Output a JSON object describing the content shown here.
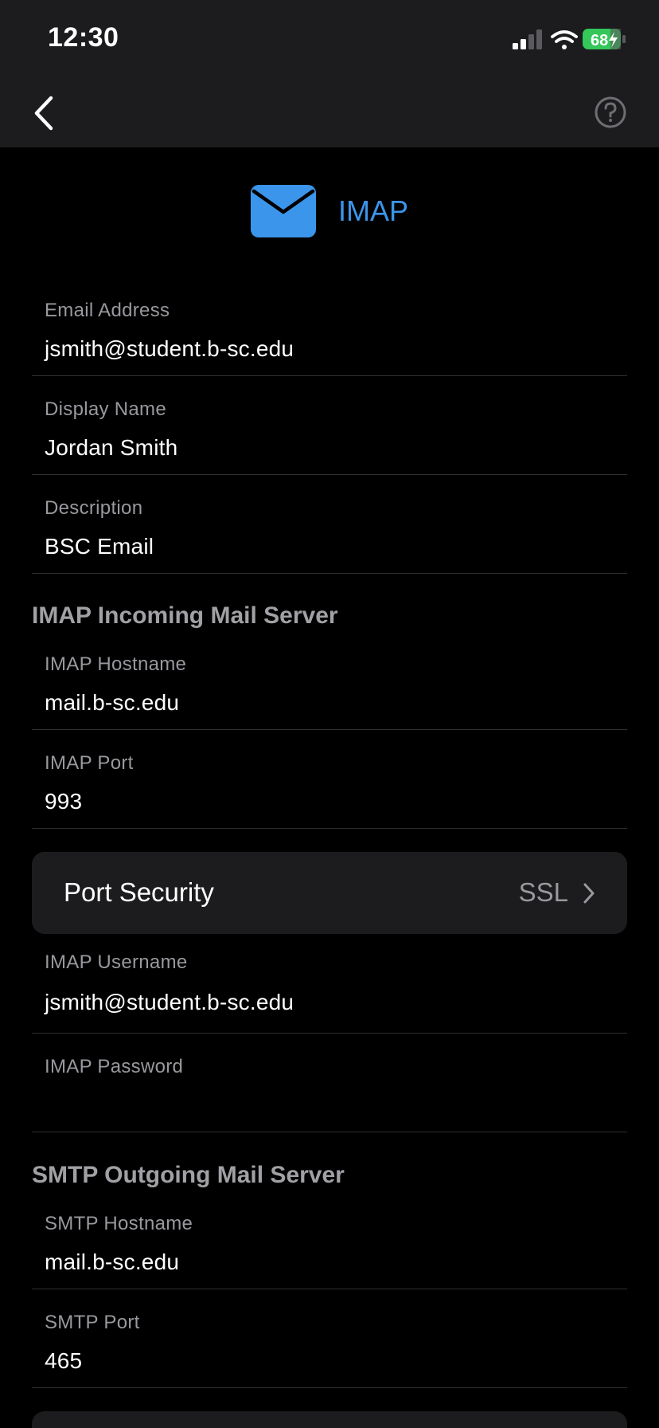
{
  "status_bar": {
    "time": "12:30",
    "battery": "68"
  },
  "header": {
    "title": "IMAP",
    "icon": "envelope-icon",
    "accent": "#3b95ea"
  },
  "account": {
    "email": {
      "label": "Email Address",
      "value": "jsmith@student.b-sc.edu"
    },
    "display_name": {
      "label": "Display Name",
      "value": "Jordan Smith"
    },
    "description": {
      "label": "Description",
      "value": "BSC Email"
    }
  },
  "incoming": {
    "heading": "IMAP Incoming Mail Server",
    "hostname": {
      "label": "IMAP Hostname",
      "value": "mail.b-sc.edu"
    },
    "port": {
      "label": "IMAP Port",
      "value": "993"
    },
    "security": {
      "label": "Port Security",
      "value": "SSL"
    },
    "username": {
      "label": "IMAP Username",
      "value": "jsmith@student.b-sc.edu"
    },
    "password": {
      "label": "IMAP Password",
      "value": ""
    }
  },
  "outgoing": {
    "heading": "SMTP Outgoing Mail Server",
    "hostname": {
      "label": "SMTP Hostname",
      "value": "mail.b-sc.edu"
    },
    "port": {
      "label": "SMTP Port",
      "value": "465"
    }
  }
}
